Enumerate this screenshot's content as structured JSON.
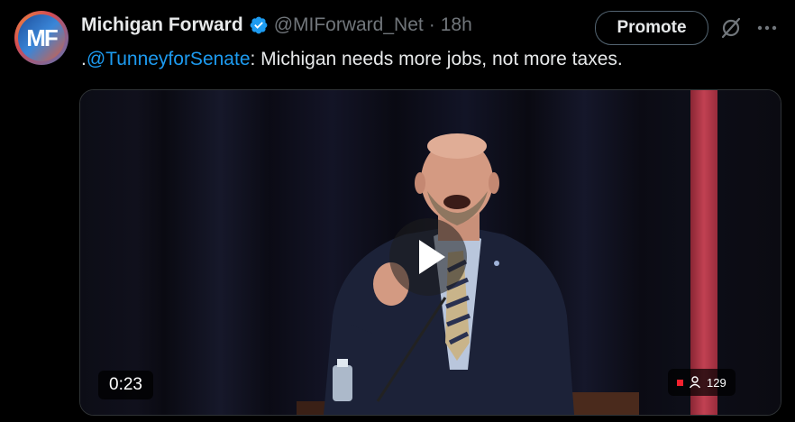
{
  "post": {
    "author_name": "Michigan Forward",
    "avatar_initials": "MF",
    "handle": "@MIForward_Net",
    "separator": "·",
    "time": "18h",
    "text_prefix": ".",
    "mention": "@TunneyforSenate",
    "text_body": ": Michigan needs more jobs, not more taxes."
  },
  "actions": {
    "promote_label": "Promote",
    "grok_icon": "grok-icon",
    "more_icon": "more-icon"
  },
  "video": {
    "duration": "0:23",
    "views": "129"
  },
  "colors": {
    "accent": "#1d9bf0",
    "verified": "#1d9bf0",
    "background": "#000000",
    "muted": "#71767b"
  }
}
